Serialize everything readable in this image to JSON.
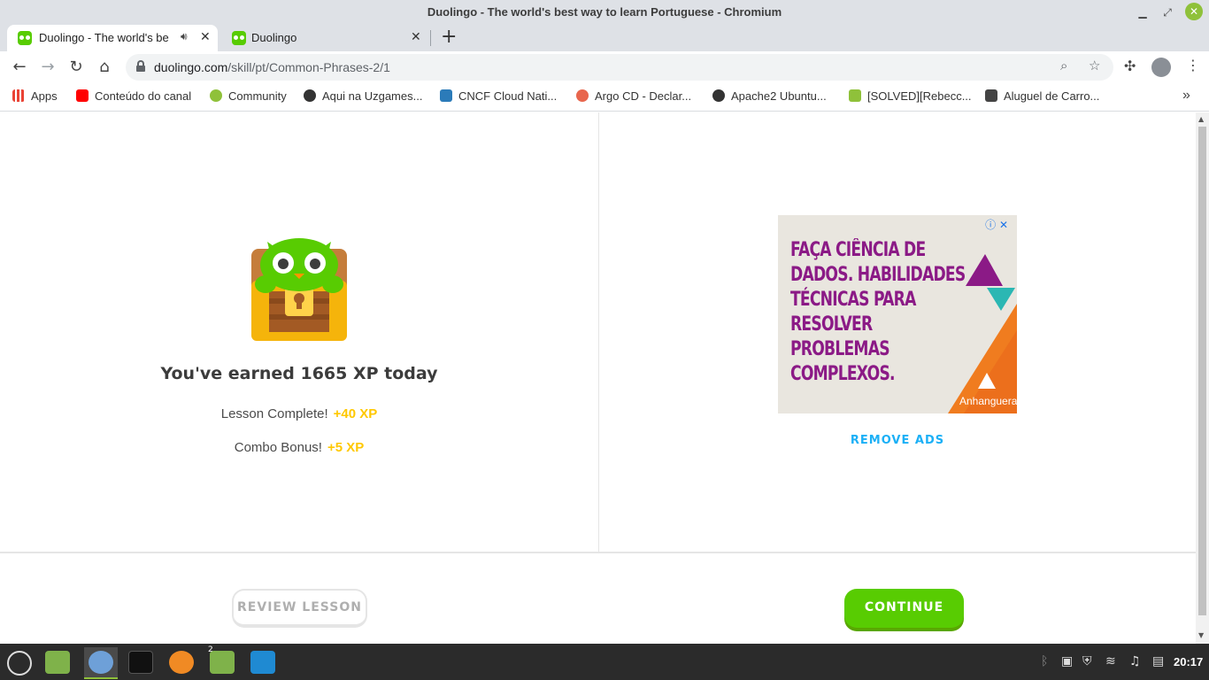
{
  "window": {
    "title": "Duolingo - The world's best way to learn Portuguese - Chromium"
  },
  "tabs": [
    {
      "title": "Duolingo - The world's be"
    },
    {
      "title": "Duolingo"
    }
  ],
  "address": {
    "domain": "duolingo.com",
    "path": "/skill/pt/Common-Phrases-2/1"
  },
  "bookmarks": [
    {
      "label": "Apps",
      "color": "#4285f4"
    },
    {
      "label": "Conteúdo do canal",
      "color": "#ff0000"
    },
    {
      "label": "Community",
      "color": "#8fc13a"
    },
    {
      "label": "Aqui na Uzgames...",
      "color": "#333333"
    },
    {
      "label": "CNCF Cloud Nati...",
      "color": "#2b7bb9"
    },
    {
      "label": "Argo CD - Declar...",
      "color": "#e8664d"
    },
    {
      "label": "Apache2 Ubuntu...",
      "color": "#333333"
    },
    {
      "label": "[SOLVED][Rebecc...",
      "color": "#8fc13a"
    },
    {
      "label": "Aluguel de Carro...",
      "color": "#444444"
    }
  ],
  "lesson": {
    "earned": "You've earned 1665 XP today",
    "rows": [
      {
        "label": "Lesson Complete!",
        "xp": "+40 XP"
      },
      {
        "label": "Combo Bonus!",
        "xp": "+5 XP"
      }
    ]
  },
  "ad": {
    "lines": [
      "FAÇA CIÊNCIA DE",
      "DADOS. HABILIDADES",
      "TÉCNICAS PARA",
      "RESOLVER",
      "PROBLEMAS",
      "COMPLEXOS."
    ],
    "brand": "Anhanguera",
    "remove_label": "REMOVE ADS"
  },
  "buttons": {
    "review": "REVIEW LESSON",
    "continue": "CONTINUE"
  },
  "taskbar": {
    "clock": "20:17",
    "files_badge": "2"
  },
  "colors": {
    "accent_green": "#58cc02",
    "xp_gold": "#ffc800",
    "link_blue": "#1cb0f6",
    "ad_purple": "#8b1a86"
  }
}
